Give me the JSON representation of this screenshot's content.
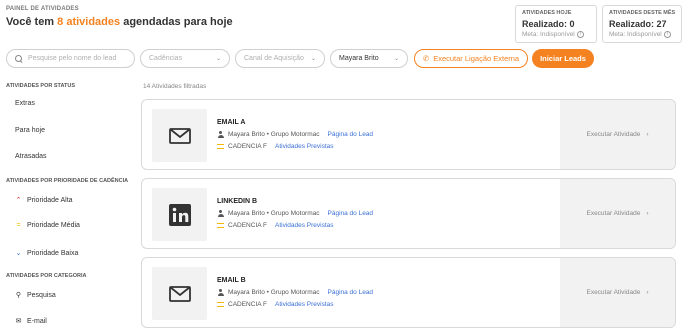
{
  "header": {
    "section_label": "PAINEL DE ATIVIDADES",
    "title_prefix": "Você tem ",
    "title_accent": "8 atividades",
    "title_suffix": " agendadas para hoje"
  },
  "stats": [
    {
      "label": "ATIVIDADES HOJE",
      "value": "Realizado: 0",
      "meta": "Meta: Indisponível"
    },
    {
      "label": "ATIVIDADES DESTE MÊS",
      "value": "Realizado: 27",
      "meta": "Meta: Indisponível"
    }
  ],
  "filters": {
    "search_placeholder": "Pesquise pelo nome do lead",
    "cadencia_placeholder": "Cadências",
    "canal_placeholder": "Canal de Aquisição",
    "user_value": "Mayara Brito",
    "call_button": "Executar Ligação Externa",
    "start_button": "Iniciar Leads"
  },
  "sidebar": {
    "status_heading": "ATIVIDADES POR STATUS",
    "status_items": [
      "Extras",
      "Para hoje",
      "Atrasadas"
    ],
    "priority_heading": "ATIVIDADES POR PRIORIDADE DE CADÊNCIA",
    "priority_items": [
      "Prioridade Alta",
      "Prioridade Média",
      "Prioridade Baixa"
    ],
    "category_heading": "ATIVIDADES POR CATEGORIA",
    "category_items": [
      "Pesquisa",
      "E-mail"
    ]
  },
  "colors": {
    "accent": "#f58220",
    "link": "#3b6fd6",
    "priority_high": "#d93025",
    "priority_medium": "#f5b800",
    "priority_low": "#3b6fd6"
  },
  "list": {
    "filtered_count": "14 Atividades filtradas",
    "activities": [
      {
        "icon": "mail-icon",
        "title": "EMAIL A",
        "lead": "Mayara Brito • Grupo Motormac",
        "lead_link": "Página do Lead",
        "cadence": "CADENCIA F",
        "cadence_link": "Atividades Previstas",
        "action": "Executar Atividade"
      },
      {
        "icon": "linkedin-icon",
        "title": "LINKEDIN B",
        "lead": "Mayara Brito • Grupo Motormac",
        "lead_link": "Página do Lead",
        "cadence": "CADENCIA F",
        "cadence_link": "Atividades Previstas",
        "action": "Executar Atividade"
      },
      {
        "icon": "mail-icon",
        "title": "EMAIL B",
        "lead": "Mayara Brito • Grupo Motormac",
        "lead_link": "Página do Lead",
        "cadence": "CADENCIA F",
        "cadence_link": "Atividades Previstas",
        "action": "Executar Atividade"
      }
    ]
  }
}
